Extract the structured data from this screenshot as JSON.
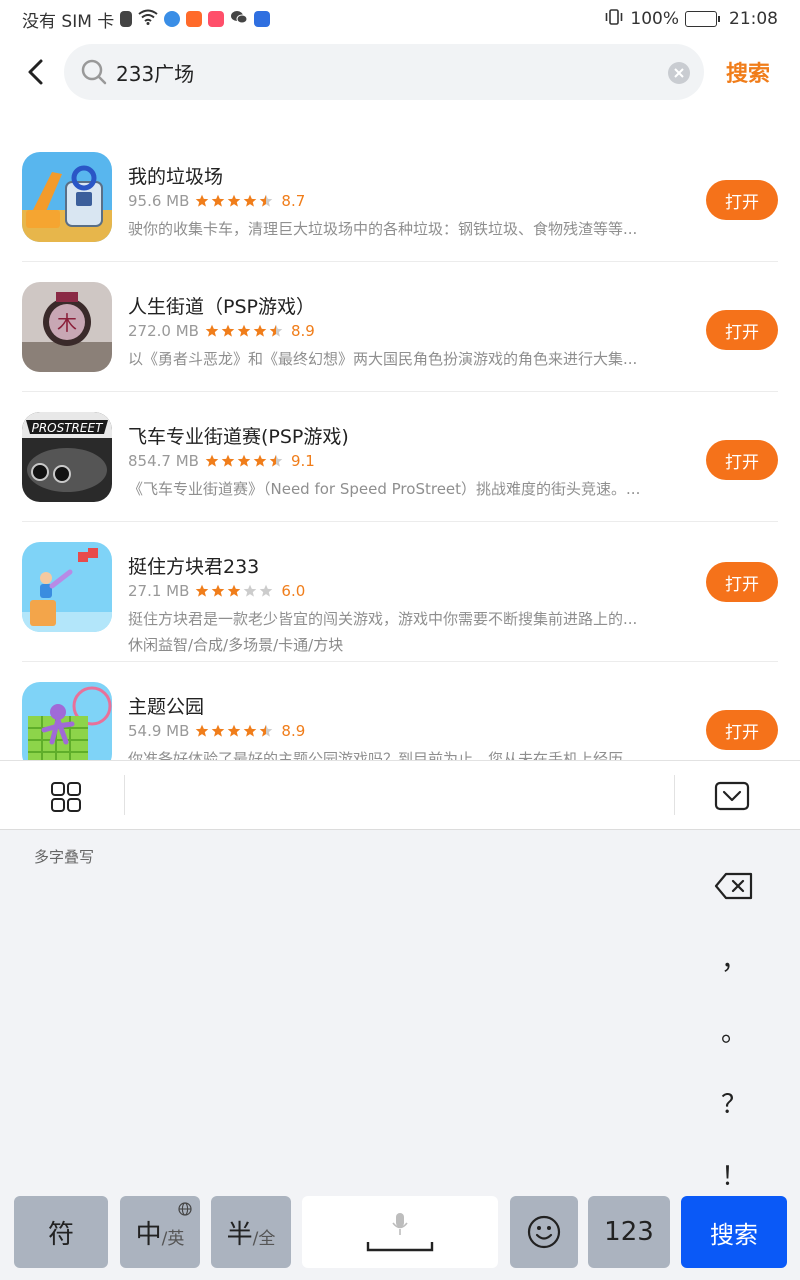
{
  "status_bar": {
    "left_text": "没有 SIM 卡",
    "battery_percent": "100%",
    "time": "21:08"
  },
  "search": {
    "query": "233广场",
    "search_button_label": "搜索"
  },
  "apps": [
    {
      "title": "我的垃圾场",
      "size": "95.6 MB",
      "rating": "8.7",
      "stars": 4.5,
      "description": "驶你的收集卡车，清理巨大垃圾场中的各种垃圾：钢铁垃圾、食物残渣等等...",
      "tags": "",
      "button_label": "打开"
    },
    {
      "title": "人生街道（PSP游戏）",
      "size": "272.0 MB",
      "rating": "8.9",
      "stars": 4.5,
      "description": "以《勇者斗恶龙》和《最终幻想》两大国民角色扮演游戏的角色来进行大集...",
      "tags": "",
      "button_label": "打开"
    },
    {
      "title": "飞车专业街道赛(PSP游戏)",
      "size": "854.7 MB",
      "rating": "9.1",
      "stars": 4.5,
      "description": "《飞车专业街道赛》（Need for Speed ProStreet）挑战难度的街头竞速。...",
      "tags": "",
      "button_label": "打开"
    },
    {
      "title": "挺住方块君233",
      "size": "27.1 MB",
      "rating": "6.0",
      "stars": 3,
      "description": "挺住方块君是一款老少皆宜的闯关游戏，游戏中你需要不断搜集前进路上的...",
      "tags": "休闲益智/合成/多场景/卡通/方块",
      "button_label": "打开"
    },
    {
      "title": "主题公园",
      "size": "54.9 MB",
      "rating": "8.9",
      "stars": 4.5,
      "description": "你准备好体验了最好的主题公园游戏吗？到目前为止，您从未在手机上经历...",
      "tags": "",
      "button_label": "打开"
    }
  ],
  "keyboard": {
    "handwriting_label": "多字叠写",
    "side_keys": [
      "，",
      "。",
      "？",
      "！"
    ],
    "keys": {
      "symbol": "符",
      "lang_main": "中",
      "lang_sub": "/英",
      "width_main": "半",
      "width_sub": "/全",
      "numbers": "123",
      "search": "搜索"
    }
  },
  "colors": {
    "accent_orange": "#f5721a",
    "star_orange": "#f07d1a",
    "key_blue": "#0a59f7",
    "key_gray": "#abb3bf"
  }
}
